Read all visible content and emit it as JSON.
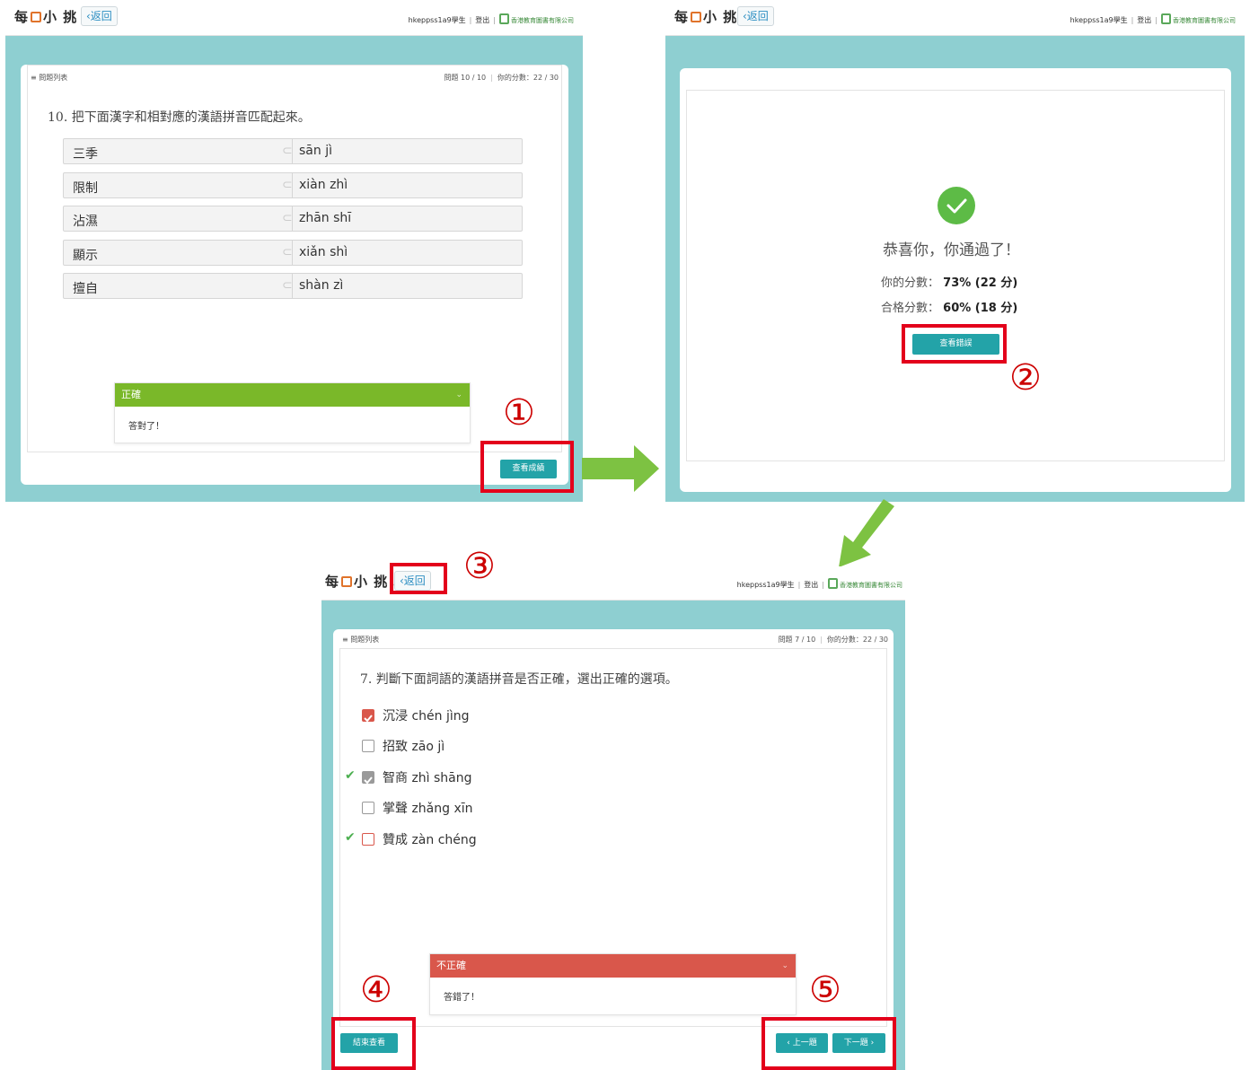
{
  "common": {
    "logo": {
      "before": "每",
      "after": "小 挑 戰"
    },
    "back_label": "‹返回",
    "user": "hkeppss1a9學生",
    "logout": "登出",
    "publisher": "香港教育圖書有限公司",
    "question_list": "≡ 問題列表"
  },
  "panel1": {
    "progress": "問題 10 / 10",
    "score": "你的分數：22 / 30",
    "question": "10. 把下面漢字和相對應的漢語拼音匹配起來。",
    "pairs": [
      {
        "left": "三季",
        "right": "sān jì"
      },
      {
        "left": "限制",
        "right": "xiàn zhì"
      },
      {
        "left": "沾濕",
        "right": "zhān shī"
      },
      {
        "left": "顯示",
        "right": "xiǎn shì"
      },
      {
        "left": "擅自",
        "right": "shàn zì"
      }
    ],
    "feedback_title": "正確",
    "feedback_text": "答對了！",
    "view_result_label": "查看成績",
    "callout": "①"
  },
  "panel2": {
    "congrats": "恭喜你，你通過了！",
    "your_score_label": "你的分數：",
    "your_score_value": "73% (22 分)",
    "pass_score_label": "合格分數：",
    "pass_score_value": "60% (18 分)",
    "review_label": "查看錯誤",
    "callout": "②"
  },
  "panel3": {
    "progress": "問題 7 / 10",
    "score": "你的分數：22 / 30",
    "question": "7. 判斷下面詞語的漢語拼音是否正確，選出正確的選項。",
    "options": [
      {
        "text": "沉浸  chén jìng",
        "state": "checked-red",
        "tick": false
      },
      {
        "text": "招致  zāo jì",
        "state": "unchecked",
        "tick": false
      },
      {
        "text": "智商  zhì shāng",
        "state": "checked-grey",
        "tick": true
      },
      {
        "text": "掌聲  zhǎng xīn",
        "state": "unchecked",
        "tick": false
      },
      {
        "text": "贊成  zàn chéng",
        "state": "unchecked",
        "tick": true
      }
    ],
    "feedback_title": "不正確",
    "feedback_text": "答錯了！",
    "end_review_label": "結束查看",
    "prev_label": "‹ 上一題",
    "next_label": "下一題 ›",
    "callouts": [
      "③",
      "④",
      "⑤"
    ]
  },
  "colors": {
    "teal_bg": "#8ecfd1",
    "button": "#23a3a8",
    "correct_green": "#7ab829",
    "wrong_red": "#d9574b",
    "highlight_red": "#e3001b",
    "arrow_green": "#7dc242"
  }
}
